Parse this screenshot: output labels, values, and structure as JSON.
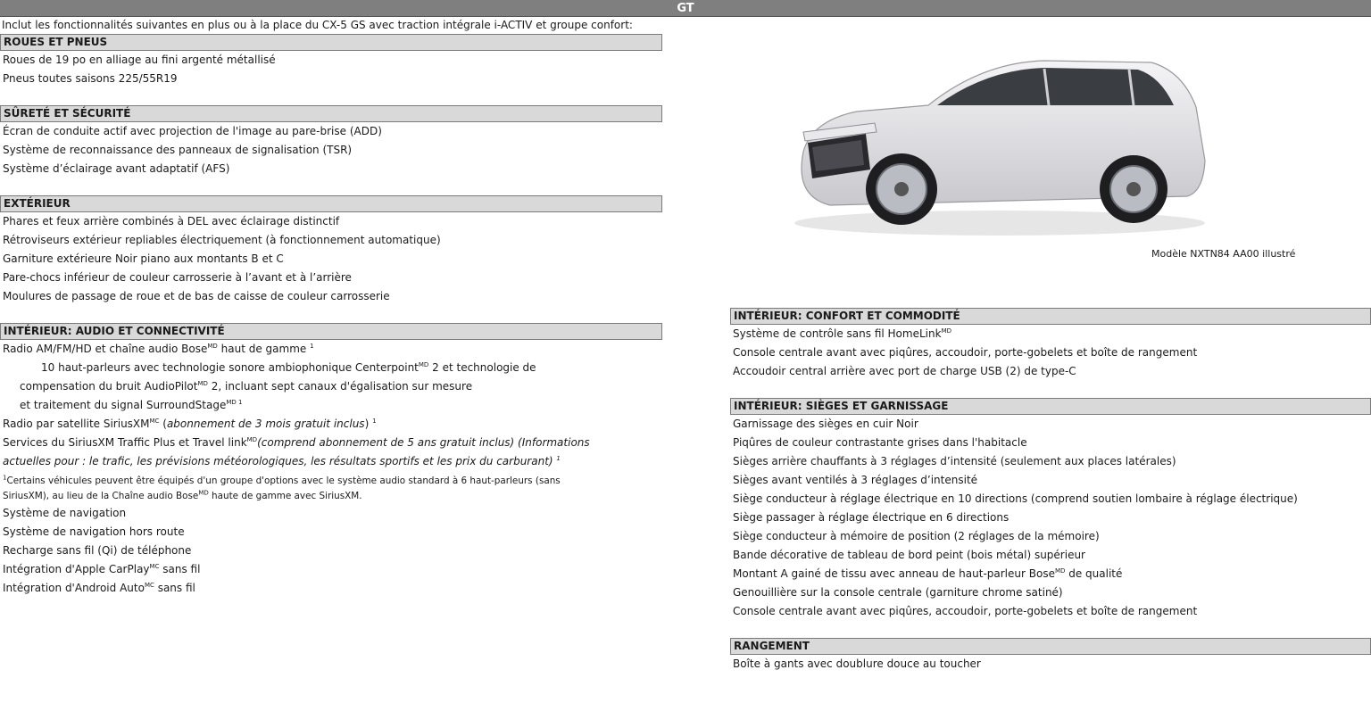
{
  "header": {
    "title": "GT"
  },
  "intro": "Inclut les fonctionnalités suivantes en plus ou à la place du CX-5 GS avec traction intégrale i-ACTIV et groupe confort:",
  "sections_left": [
    {
      "title": "ROUES ET PNEUS",
      "items": [
        "Roues de 19 po en alliage au fini argenté métallisé",
        "Pneus toutes saisons 225/55R19"
      ]
    },
    {
      "title": "SÛRETÉ ET SÉCURITÉ",
      "items": [
        "Écran de conduite actif avec projection de l'image au pare-brise (ADD)",
        "Système de reconnaissance des panneaux de signalisation (TSR)",
        "Système d’éclairage avant adaptatif (AFS)"
      ]
    },
    {
      "title": "EXTÉRIEUR",
      "items": [
        "Phares et feux arrière combinés à DEL avec éclairage distinctif",
        "Rétroviseurs extérieur repliables électriquement (à fonctionnement automatique)",
        "Garniture extérieure Noir piano aux montants B et C",
        "Pare-chocs inférieur de couleur carrosserie à l’avant et à l’arrière",
        "Moulures de passage de roue et de bas de caisse de couleur carrosserie"
      ]
    },
    {
      "title": "INTÉRIEUR: AUDIO ET CONNECTIVITÉ",
      "audio": {
        "radio_a": "Radio AM/FM/HD  et chaîne audio Bose",
        "radio_b": " haut de gamme ",
        "sp_a": "10 haut-parleurs avec technologie sonore ambiophonique Centerpoint",
        "sp_b": " 2 et technologie de",
        "comp_a": "compensation  du bruit AudioPilot",
        "comp_b": " 2,  incluant sept canaux d'égalisation sur mesure",
        "surr": "et traitement du signal SurroundStage",
        "sat_a": "Radio par satellite SiriusXM",
        "sat_b": "abonnement de 3 mois gratuit inclus",
        "traffic_a": "Services du SiriusXM Traffic Plus et Travel link",
        "traffic_b": "(comprend abonnement de 5 ans gratuit inclus) (Informations",
        "traffic_c": "actuelles pour : le trafic, les prévisions météorologiques, les résultats sportifs et les prix du carburant)",
        "note_a": "Certains véhicules peuvent être équipés d'un groupe d'options avec le système audio standard à 6 haut-parleurs (sans",
        "note_b": "SiriusXM), au lieu de la Chaîne audio Bose",
        "note_c": " haute de gamme avec SiriusXM.",
        "nav": "Système de navigation",
        "offroad": "Système de navigation hors route",
        "qi": "Recharge sans fil (Qi) de téléphone",
        "carplay": "Intégration d'Apple CarPlay",
        "carplay_b": " sans fil",
        "android": "Intégration d'Android Auto",
        "android_b": " sans fil",
        "md": "MD",
        "mc": "MC",
        "md1": "MD 1",
        "one": "1"
      }
    }
  ],
  "image": {
    "caption": "Modèle NXTN84 AA00 illustré"
  },
  "sections_right": [
    {
      "title": "INTÉRIEUR: CONFORT ET COMMODITÉ",
      "homelink": "Système de contrôle sans fil HomeLink",
      "items": [
        "Console centrale avant avec piqûres, accoudoir, porte-gobelets et boîte de rangement",
        "Accoudoir central arrière avec port de charge USB (2) de type-C"
      ]
    },
    {
      "title": "INTÉRIEUR: SIÈGES ET GARNISSAGE",
      "items": [
        "Garnissage des sièges en cuir Noir",
        "Piqûres de couleur contrastante grises dans l'habitacle",
        "Sièges arrière chauffants à 3 réglages d’intensité (seulement aux places latérales)",
        "Sièges avant ventilés à 3 réglages d’intensité",
        "Siège conducteur à réglage électrique en 10 directions (comprend soutien lombaire à réglage électrique)",
        "Siège passager à réglage électrique en 6 directions",
        "Siège conducteur à mémoire de position (2 réglages de la mémoire)",
        "Bande décorative de tableau de bord peint (bois métal) supérieur"
      ],
      "pillar_a": "Montant A gainé de tissu avec anneau de haut-parleur Bose",
      "pillar_b": " de qualité",
      "items2": [
        "Genouillière sur la console centrale (garniture chrome satiné)",
        "Console centrale avant avec piqûres, accoudoir, porte-gobelets et boîte de rangement"
      ]
    },
    {
      "title": "RANGEMENT",
      "items": [
        "Boîte à gants avec doublure douce au toucher"
      ]
    }
  ],
  "colors": {
    "header_bg": "#7f7f7f",
    "section_bg": "#d9d9d9",
    "car_body": "#e8e8ea"
  }
}
